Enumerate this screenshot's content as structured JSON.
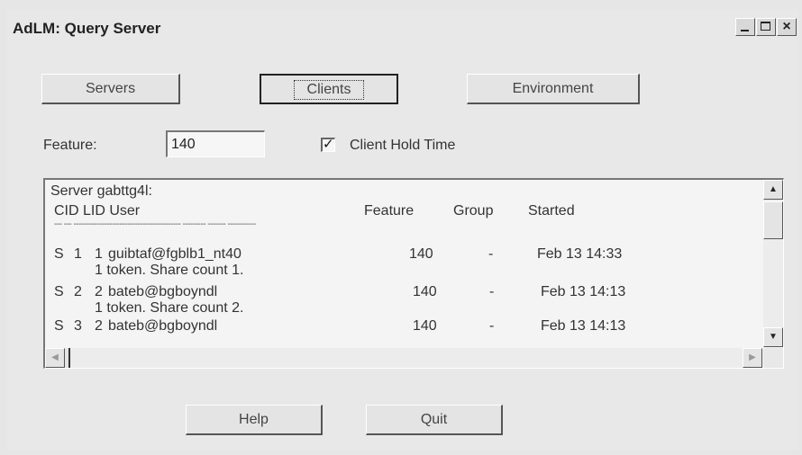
{
  "window": {
    "title": "AdLM: Query Server",
    "controls": {
      "minimize": "_",
      "close": "×"
    }
  },
  "toolbar": {
    "servers_label": "Servers",
    "clients_label": "Clients",
    "environment_label": "Environment"
  },
  "feature": {
    "label": "Feature:",
    "value": "140"
  },
  "client_hold_time": {
    "label": "Client Hold Time",
    "checked": true,
    "check_glyph": "✓"
  },
  "listing": {
    "server_line": "Server gabttg4l:",
    "headers": {
      "cid_lid_user": "CID LID User",
      "feature": "Feature",
      "group": "Group",
      "started": "Started"
    },
    "separator": "--- --- ------------------------------------------ --------- ------- -----------",
    "rows": [
      {
        "s": "S",
        "cid": "1",
        "lid": "1",
        "user": "guibtaf@fgblb1_nt40",
        "feature": "140",
        "group": "-",
        "started": "Feb 13 14:33",
        "detail": "1 token. Share count 1."
      },
      {
        "s": "S",
        "cid": "2",
        "lid": "2",
        "user": "bateb@bgboyndl",
        "feature": "140",
        "group": "-",
        "started": "Feb 13 14:13",
        "detail": "1 token. Share count 2."
      },
      {
        "s": "S",
        "cid": "3",
        "lid": "2",
        "user": "bateb@bgboyndl",
        "feature": "140",
        "group": "-",
        "started": "Feb 13 14:13",
        "detail": ""
      }
    ]
  },
  "footer": {
    "help_label": "Help",
    "quit_label": "Quit"
  },
  "icons": {
    "scroll_up": "▲",
    "scroll_down": "▼",
    "scroll_left": "◀",
    "scroll_right": "▶"
  }
}
